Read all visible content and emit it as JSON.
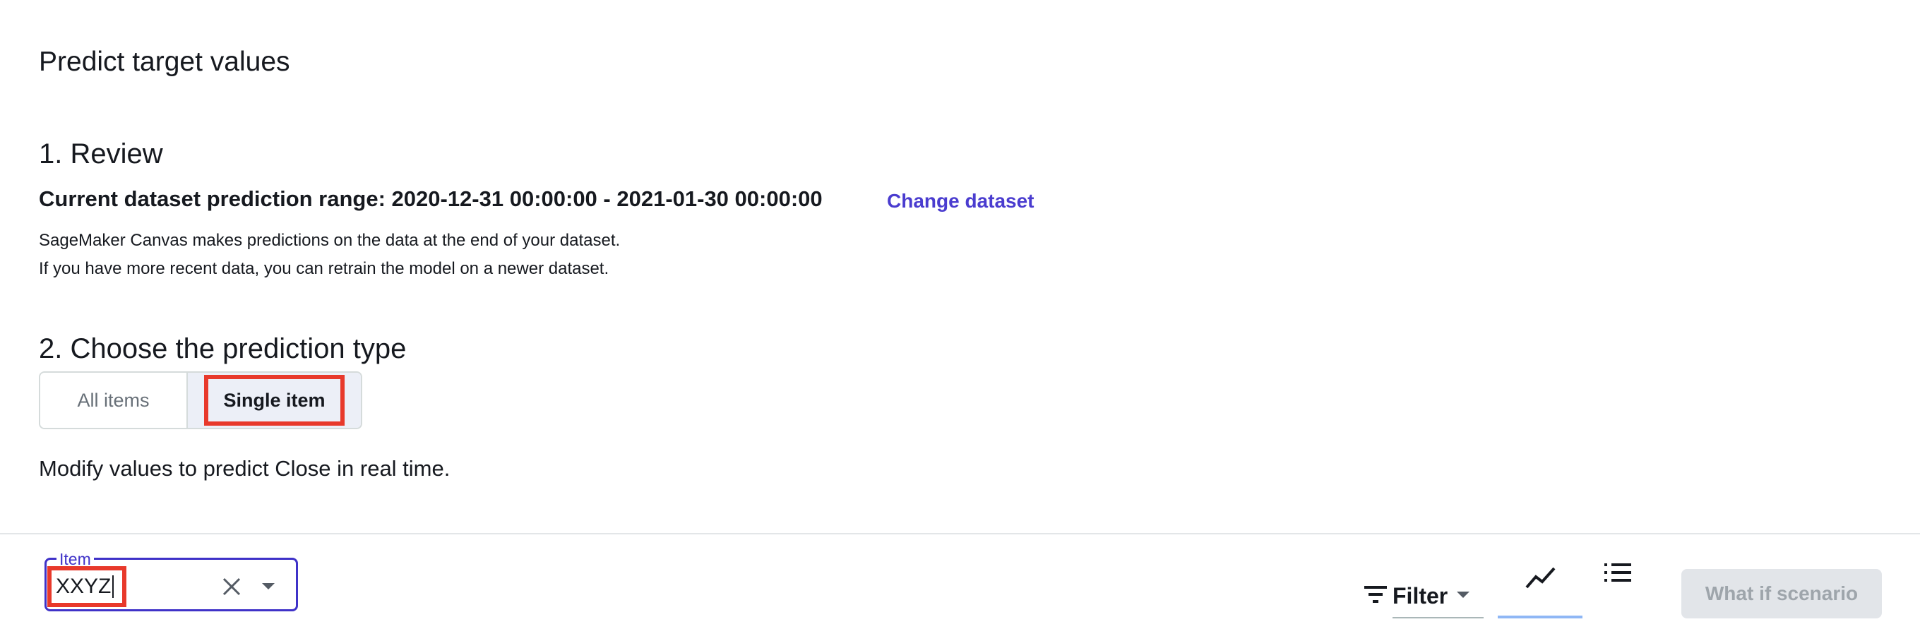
{
  "page": {
    "title": "Predict target values"
  },
  "review": {
    "heading": "1. Review",
    "range_text": "Current dataset prediction range: 2020-12-31 00:00:00 - 2021-01-30 00:00:00",
    "change_link": "Change dataset",
    "desc_line1": "SageMaker Canvas makes predictions on the data at the end of your dataset.",
    "desc_line2": "If you have more recent data, you can retrain the model on a newer dataset."
  },
  "prediction_type": {
    "heading": "2. Choose the prediction type",
    "options": [
      "All items",
      "Single item"
    ],
    "selected": "Single item"
  },
  "modify_text": "Modify values to predict Close in real time.",
  "toolbar": {
    "item_label": "Item",
    "item_value": "XXYZ",
    "filter_label": "Filter",
    "whatif_label": "What if scenario"
  },
  "colors": {
    "accent": "#3f32c8",
    "highlight": "#e8392b",
    "link": "#4a3ccf"
  }
}
